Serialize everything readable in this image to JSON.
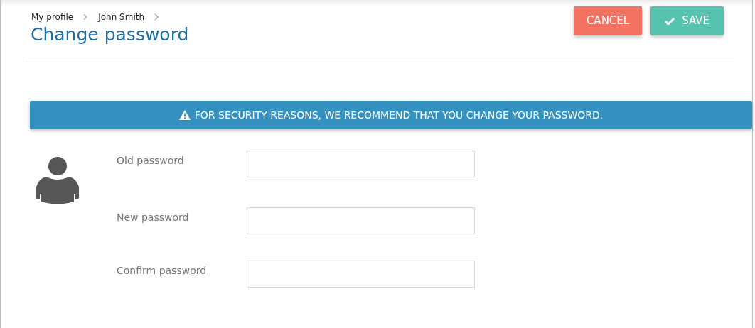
{
  "breadcrumb": [
    "My profile",
    "John Smith"
  ],
  "page_title": "Change password",
  "buttons": [
    {
      "label": "CANCEL",
      "kind": "cancel"
    },
    {
      "label": "SAVE",
      "kind": "save"
    }
  ],
  "alert": {
    "text": "FOR SECURITY REASONS, WE RECOMMEND THAT YOU CHANGE YOUR PASSWORD."
  },
  "fields": [
    {
      "label": "Old password"
    },
    {
      "label": "New password"
    },
    {
      "label": "Confirm password"
    }
  ]
}
